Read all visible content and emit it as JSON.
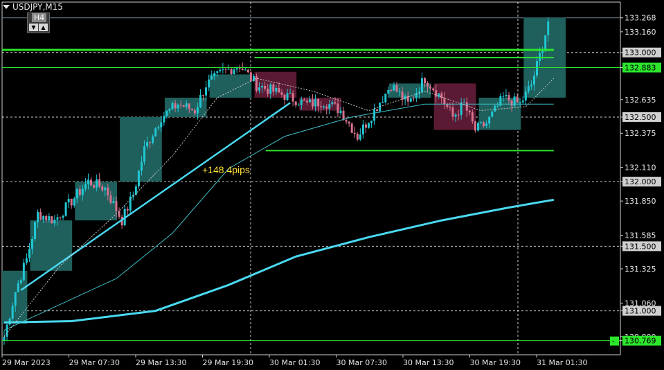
{
  "header": {
    "symbol_label": "USDJPY,M15"
  },
  "toolbar": {
    "timeframe": "H4",
    "down_icon": "triangle-down-icon",
    "up_icon": "triangle-up-icon"
  },
  "annotation": {
    "pips_text": "+148.4pips",
    "color": "#ffe135"
  },
  "colors": {
    "bull_box": "#1f5f5c",
    "bear_box": "#5a1a33",
    "bull_candle": "#21c7d3",
    "bear_candle": "#d8738f",
    "ma_long": "#49d9f0",
    "level_green": "#2ce62c"
  },
  "chart_data": {
    "type": "candlestick",
    "symbol": "USDJPY",
    "timeframe": "M15",
    "ylim": [
      130.66,
      133.39
    ],
    "y_ticks": [
      "133.268",
      "133.160",
      "133.000",
      "132.883",
      "132.635",
      "132.500",
      "132.375",
      "132.110",
      "132.000",
      "131.850",
      "131.585",
      "131.500",
      "131.325",
      "131.060",
      "131.000",
      "130.800",
      "130.769"
    ],
    "x_ticks": [
      "29 Mar 2023",
      "29 Mar 07:30",
      "29 Mar 13:30",
      "29 Mar 19:30",
      "30 Mar 01:30",
      "30 Mar 07:30",
      "30 Mar 13:30",
      "30 Mar 19:30",
      "31 Mar 01:30"
    ],
    "highlighted_prices": [
      "133.000",
      "132.883",
      "132.500",
      "132.000",
      "131.500",
      "131.000",
      "130.769"
    ],
    "price_anchors": [
      {
        "bar": 0,
        "price": 130.8
      },
      {
        "bar": 4,
        "price": 131.15
      },
      {
        "bar": 8,
        "price": 131.4
      },
      {
        "bar": 12,
        "price": 131.75
      },
      {
        "bar": 18,
        "price": 131.7
      },
      {
        "bar": 24,
        "price": 131.85
      },
      {
        "bar": 30,
        "price": 132.0
      },
      {
        "bar": 36,
        "price": 131.95
      },
      {
        "bar": 42,
        "price": 131.7
      },
      {
        "bar": 46,
        "price": 131.9
      },
      {
        "bar": 50,
        "price": 132.25
      },
      {
        "bar": 56,
        "price": 132.5
      },
      {
        "bar": 62,
        "price": 132.6
      },
      {
        "bar": 68,
        "price": 132.55
      },
      {
        "bar": 72,
        "price": 132.75
      },
      {
        "bar": 78,
        "price": 132.85
      },
      {
        "bar": 84,
        "price": 132.9
      },
      {
        "bar": 90,
        "price": 132.75
      },
      {
        "bar": 96,
        "price": 132.7
      },
      {
        "bar": 102,
        "price": 132.65
      },
      {
        "bar": 108,
        "price": 132.6
      },
      {
        "bar": 114,
        "price": 132.62
      },
      {
        "bar": 120,
        "price": 132.55
      },
      {
        "bar": 126,
        "price": 132.35
      },
      {
        "bar": 132,
        "price": 132.55
      },
      {
        "bar": 138,
        "price": 132.75
      },
      {
        "bar": 144,
        "price": 132.6
      },
      {
        "bar": 150,
        "price": 132.8
      },
      {
        "bar": 156,
        "price": 132.65
      },
      {
        "bar": 160,
        "price": 132.5
      },
      {
        "bar": 164,
        "price": 132.6
      },
      {
        "bar": 168,
        "price": 132.4
      },
      {
        "bar": 172,
        "price": 132.45
      },
      {
        "bar": 178,
        "price": 132.65
      },
      {
        "bar": 184,
        "price": 132.6
      },
      {
        "bar": 188,
        "price": 132.75
      },
      {
        "bar": 192,
        "price": 133.05
      },
      {
        "bar": 194,
        "price": 133.24
      }
    ],
    "h4_boxes": [
      {
        "start_bar": 0,
        "end_bar": 8,
        "low": 130.9,
        "high": 131.31,
        "dir": "bull"
      },
      {
        "start_bar": 10,
        "end_bar": 24,
        "low": 131.31,
        "high": 131.7,
        "dir": "bull"
      },
      {
        "start_bar": 26,
        "end_bar": 40,
        "low": 131.7,
        "high": 132.0,
        "dir": "bull"
      },
      {
        "start_bar": 42,
        "end_bar": 56,
        "low": 132.0,
        "high": 132.5,
        "dir": "bull"
      },
      {
        "start_bar": 58,
        "end_bar": 72,
        "low": 132.5,
        "high": 132.65,
        "dir": "bull"
      },
      {
        "start_bar": 74,
        "end_bar": 88,
        "low": 132.65,
        "high": 132.83,
        "dir": "bull"
      },
      {
        "start_bar": 90,
        "end_bar": 104,
        "low": 132.65,
        "high": 132.85,
        "dir": "bear"
      },
      {
        "start_bar": 106,
        "end_bar": 120,
        "low": 132.55,
        "high": 132.65,
        "dir": "bear"
      },
      {
        "start_bar": 138,
        "end_bar": 152,
        "low": 132.65,
        "high": 132.76,
        "dir": "bull"
      },
      {
        "start_bar": 154,
        "end_bar": 168,
        "low": 132.4,
        "high": 132.76,
        "dir": "bear"
      },
      {
        "start_bar": 170,
        "end_bar": 184,
        "low": 132.4,
        "high": 132.65,
        "dir": "bull"
      },
      {
        "start_bar": 186,
        "end_bar": 200,
        "low": 132.65,
        "high": 133.27,
        "dir": "bull"
      }
    ],
    "levels": [
      {
        "price": 133.02,
        "from_bar": 0,
        "to_bar": 196,
        "width": 3
      },
      {
        "price": 132.96,
        "from_bar": 90,
        "to_bar": 196,
        "width": 2
      },
      {
        "price": 132.883,
        "from_bar": 0,
        "to_bar": 230,
        "width": 1
      },
      {
        "price": 132.24,
        "from_bar": 94,
        "to_bar": 196,
        "width": 2
      },
      {
        "price": 130.769,
        "from_bar": 0,
        "to_bar": 230,
        "width": 1
      }
    ],
    "trendline": {
      "from_bar": 6,
      "from_price": 131.16,
      "to_bar": 102,
      "to_price": 132.61
    },
    "ma_slow": [
      {
        "bar": 0,
        "price": 130.91
      },
      {
        "bar": 24,
        "price": 130.92
      },
      {
        "bar": 54,
        "price": 131.0
      },
      {
        "bar": 80,
        "price": 131.2
      },
      {
        "bar": 104,
        "price": 131.42
      },
      {
        "bar": 130,
        "price": 131.57
      },
      {
        "bar": 156,
        "price": 131.7
      },
      {
        "bar": 180,
        "price": 131.8
      },
      {
        "bar": 196,
        "price": 131.86
      }
    ],
    "ma_mid": [
      {
        "bar": 0,
        "price": 130.85
      },
      {
        "bar": 20,
        "price": 131.05
      },
      {
        "bar": 40,
        "price": 131.25
      },
      {
        "bar": 60,
        "price": 131.6
      },
      {
        "bar": 80,
        "price": 132.1
      },
      {
        "bar": 100,
        "price": 132.35
      },
      {
        "bar": 124,
        "price": 132.5
      },
      {
        "bar": 150,
        "price": 132.6
      },
      {
        "bar": 170,
        "price": 132.6
      },
      {
        "bar": 196,
        "price": 132.6
      }
    ],
    "ma_fast": [
      {
        "bar": 0,
        "price": 130.8
      },
      {
        "bar": 20,
        "price": 131.35
      },
      {
        "bar": 40,
        "price": 131.75
      },
      {
        "bar": 60,
        "price": 132.2
      },
      {
        "bar": 76,
        "price": 132.65
      },
      {
        "bar": 90,
        "price": 132.8
      },
      {
        "bar": 110,
        "price": 132.7
      },
      {
        "bar": 130,
        "price": 132.55
      },
      {
        "bar": 150,
        "price": 132.7
      },
      {
        "bar": 170,
        "price": 132.55
      },
      {
        "bar": 186,
        "price": 132.58
      },
      {
        "bar": 196,
        "price": 132.8
      }
    ]
  }
}
